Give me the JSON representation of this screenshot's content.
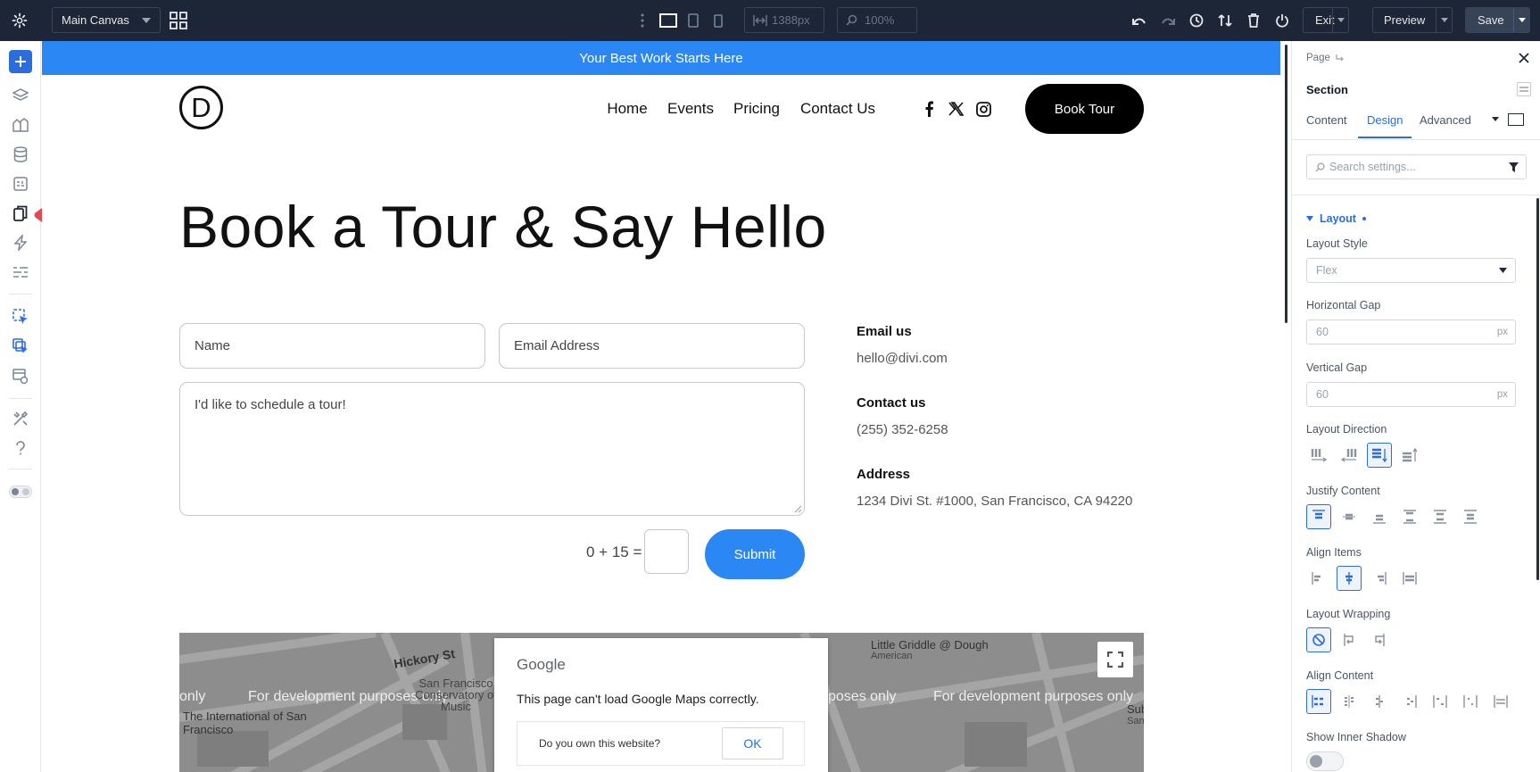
{
  "topbar": {
    "canvas_name": "Main Canvas",
    "width_value": "1388px",
    "zoom_value": "100%",
    "exit_label": "Exit",
    "preview_label": "Preview",
    "save_label": "Save"
  },
  "banner": {
    "text": "Your Best Work Starts Here"
  },
  "header": {
    "logo_letter": "D",
    "nav": [
      "Home",
      "Events",
      "Pricing",
      "Contact Us"
    ],
    "cta_label": "Book Tour"
  },
  "hero": {
    "title": "Book a Tour & Say Hello"
  },
  "form": {
    "name_placeholder": "Name",
    "email_placeholder": "Email Address",
    "message_value": "I'd like to schedule a tour!",
    "captcha_question": "0 + 15 =",
    "submit_label": "Submit"
  },
  "contact": {
    "email_title": "Email us",
    "email_value": "hello@divi.com",
    "phone_title": "Contact us",
    "phone_value": "(255) 352-6258",
    "address_title": "Address",
    "address_value": "1234 Divi St. #1000, San Francisco, CA 94220"
  },
  "map": {
    "dev_text": "For development purposes only",
    "dev_text_partial_left": "only",
    "dev_text_partial_right": "poses only",
    "labels": [
      "Hickory St",
      "San Francisco Conservatory of Music",
      "The International of San Francisco",
      "Little Griddle @ Dough",
      "American",
      "Subw",
      "Sandv"
    ],
    "dialog_brand": "Google",
    "dialog_message": "This page can't load Google Maps correctly.",
    "dialog_question": "Do you own this website?",
    "dialog_ok": "OK"
  },
  "panel": {
    "breadcrumb": "Page",
    "title": "Section",
    "tabs": [
      "Content",
      "Design",
      "Advanced"
    ],
    "active_tab": "Design",
    "search_placeholder": "Search settings...",
    "group_title": "Layout",
    "layout_style_label": "Layout Style",
    "layout_style_value": "Flex",
    "hgap_label": "Horizontal Gap",
    "hgap_value": "60",
    "vgap_label": "Vertical Gap",
    "vgap_value": "60",
    "unit": "px",
    "direction_label": "Layout Direction",
    "justify_label": "Justify Content",
    "align_items_label": "Align Items",
    "wrapping_label": "Layout Wrapping",
    "align_content_label": "Align Content",
    "inner_shadow_label": "Show Inner Shadow"
  },
  "colors": {
    "accent": "#2b87f4",
    "topbar": "#1d2636",
    "panel_accent": "#2b6cdf",
    "arrow": "#e5484d"
  }
}
